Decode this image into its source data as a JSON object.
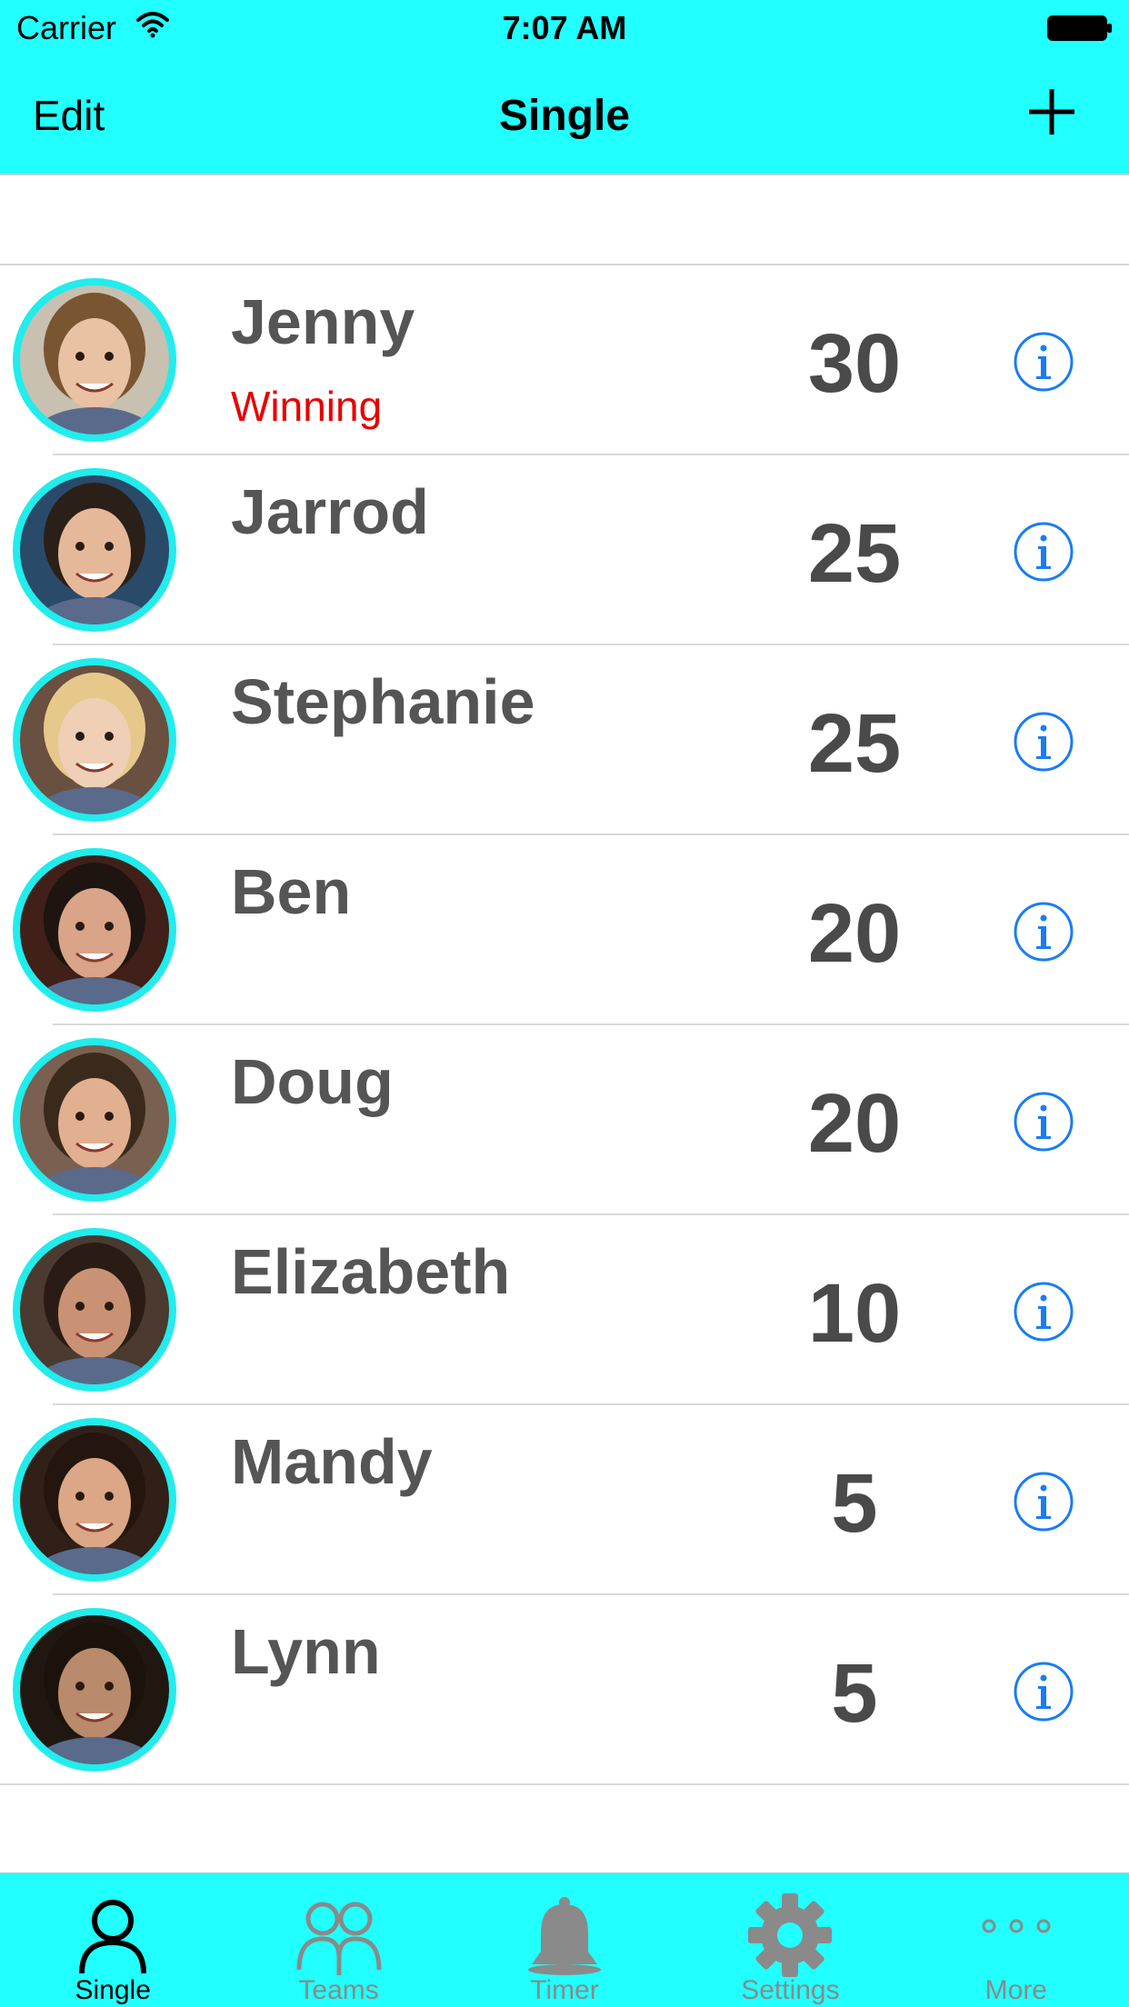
{
  "status_bar": {
    "carrier": "Carrier",
    "time": "7:07 AM"
  },
  "nav": {
    "edit_label": "Edit",
    "title": "Single",
    "add_icon": "plus-icon"
  },
  "colors": {
    "accent": "#21ffff",
    "avatar_ring": "#22ecec",
    "score_text": "#4a4a4a",
    "name_text": "#555555",
    "winning": "#e80000",
    "info_blue": "#1a7cf5"
  },
  "players": [
    {
      "name": "Jenny",
      "status": "Winning",
      "score": "30"
    },
    {
      "name": "Jarrod",
      "status": "",
      "score": "25"
    },
    {
      "name": "Stephanie",
      "status": "",
      "score": "25"
    },
    {
      "name": "Ben",
      "status": "",
      "score": "20"
    },
    {
      "name": "Doug",
      "status": "",
      "score": "20"
    },
    {
      "name": "Elizabeth",
      "status": "",
      "score": "10"
    },
    {
      "name": "Mandy",
      "status": "",
      "score": "5"
    },
    {
      "name": "Lynn",
      "status": "",
      "score": "5"
    }
  ],
  "tabs": [
    {
      "label": "Single",
      "icon": "person-icon",
      "active": true
    },
    {
      "label": "Teams",
      "icon": "people-icon",
      "active": false
    },
    {
      "label": "Timer",
      "icon": "bell-icon",
      "active": false
    },
    {
      "label": "Settings",
      "icon": "gear-icon",
      "active": false
    },
    {
      "label": "More",
      "icon": "more-icon",
      "active": false
    }
  ]
}
